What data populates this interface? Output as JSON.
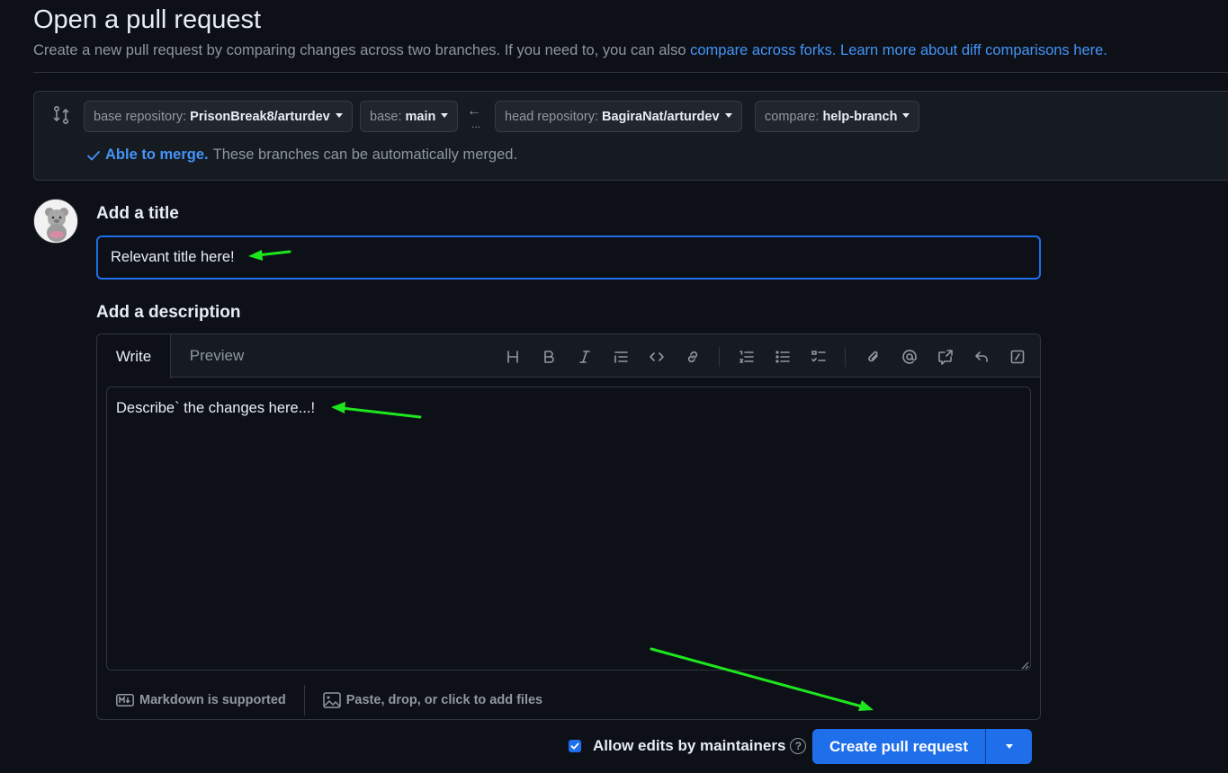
{
  "header": {
    "title": "Open a pull request",
    "subtitle_text": "Create a new pull request by comparing changes across two branches. If you need to, you can also",
    "link_forks": "compare across forks.",
    "link_learn": "Learn more about diff comparisons here."
  },
  "branches": {
    "base_repo_label": "base repository:",
    "base_repo_value": "PrisonBreak8/arturdev",
    "base_label": "base:",
    "base_value": "main",
    "head_repo_label": "head repository:",
    "head_repo_value": "BagiraNat/arturdev",
    "compare_label": "compare:",
    "compare_value": "help-branch",
    "arrow": "←",
    "dots": "...",
    "merge_ok": "Able to merge.",
    "merge_text": "These branches can be automatically merged."
  },
  "form": {
    "title_label": "Add a title",
    "title_value": "Relevant title here!",
    "desc_label": "Add a description",
    "tab_write": "Write",
    "tab_preview": "Preview",
    "desc_value": "Describe` the changes here...!",
    "markdown_note": "Markdown is supported",
    "attach_note": "Paste, drop, or click to add files"
  },
  "footer": {
    "allow_edits": "Allow edits by maintainers",
    "help": "?",
    "create_label": "Create pull request"
  },
  "colors": {
    "accent": "#1f6feb",
    "link": "#4493f8",
    "annotation": "#1ee61e"
  }
}
